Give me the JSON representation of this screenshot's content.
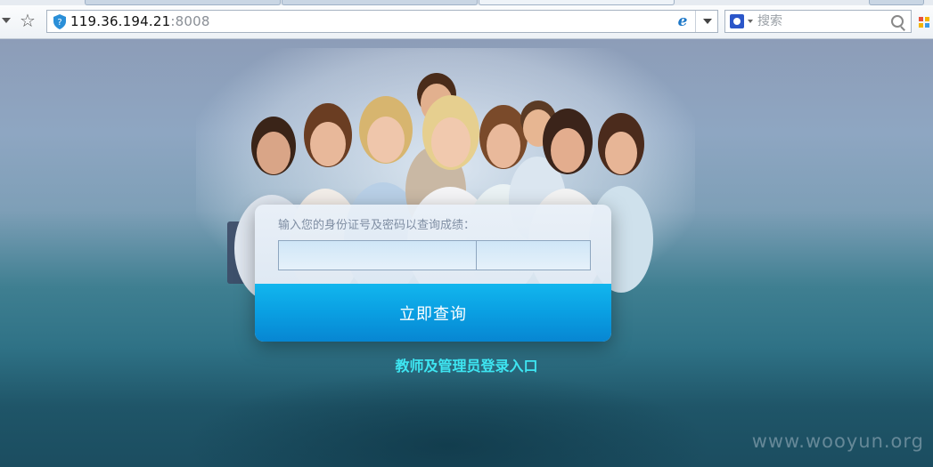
{
  "browser": {
    "url_host": "119.36.194.21",
    "url_port": ":8008",
    "search_placeholder": "搜索"
  },
  "login": {
    "prompt": "输入您的身份证号及密码以查询成绩：",
    "id_value": "",
    "password_value": "",
    "submit_label": "立即查询"
  },
  "admin_link": "教师及管理员登录入口",
  "watermark": "www.wooyun.org",
  "colors": {
    "accent_button": "#0a9fe2",
    "link": "#3ee6f2"
  }
}
